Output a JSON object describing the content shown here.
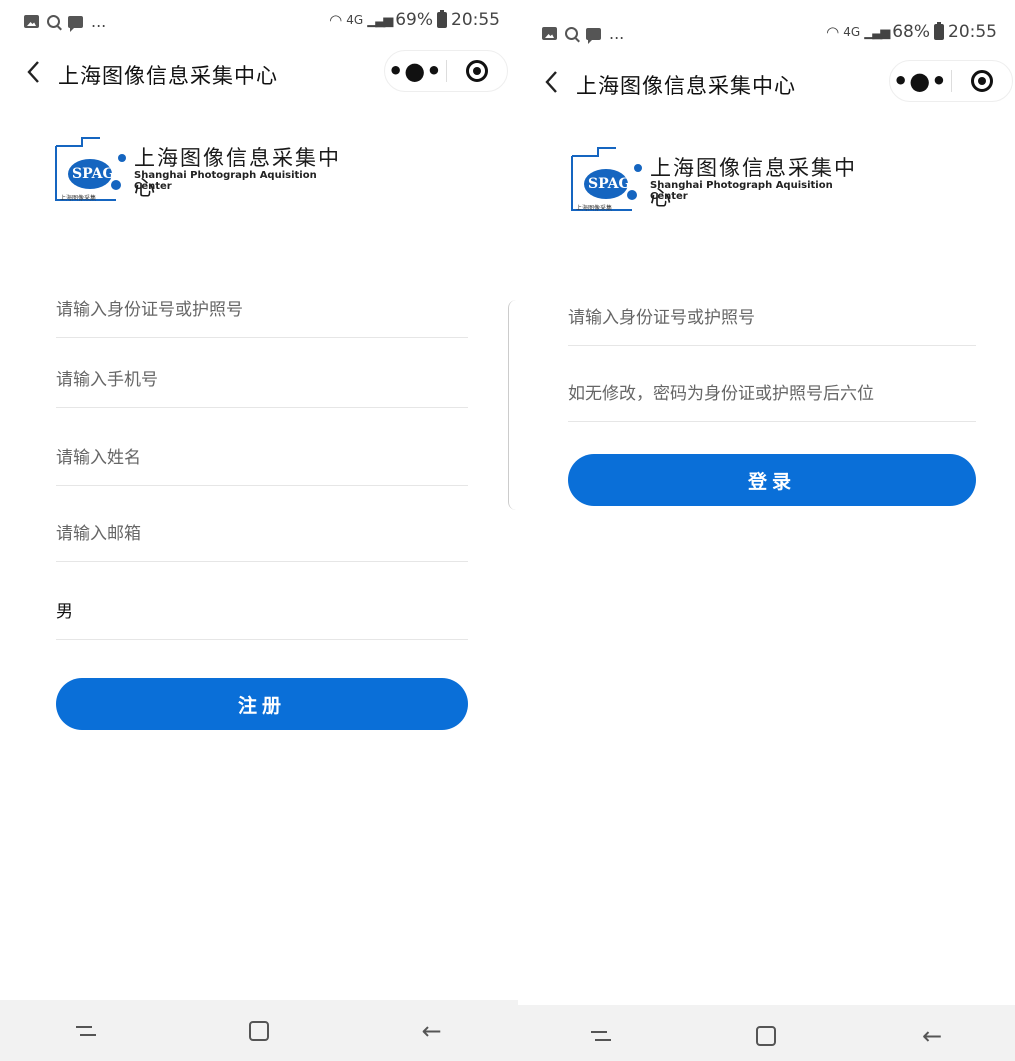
{
  "left_screen": {
    "status_bar": {
      "dots": "...",
      "network": "4G",
      "battery": "69%",
      "time": "20:55"
    },
    "nav": {
      "back_icon": "chevron-left-icon",
      "title": "上海图像信息采集中心",
      "more_icon": "more-dots-icon",
      "close_icon": "target-icon"
    },
    "logo": {
      "mark": "SPAG",
      "zh": "上海图像信息采集中心",
      "en": "Shanghai Photograph Aquisition Center",
      "small": "上海图像采集"
    },
    "fields": [
      {
        "placeholder": "请输入身份证号或护照号",
        "value": ""
      },
      {
        "placeholder": "请输入手机号",
        "value": ""
      },
      {
        "placeholder": "请输入姓名",
        "value": ""
      },
      {
        "placeholder": "请输入邮箱",
        "value": ""
      }
    ],
    "gender_value": "男",
    "register_button": "注册"
  },
  "right_screen": {
    "status_bar": {
      "dots": "...",
      "network": "4G",
      "battery": "68%",
      "time": "20:55"
    },
    "nav": {
      "back_icon": "chevron-left-icon",
      "title": "上海图像信息采集中心",
      "more_icon": "more-dots-icon",
      "close_icon": "target-icon"
    },
    "logo": {
      "mark": "SPAG",
      "zh": "上海图像信息采集中心",
      "en": "Shanghai Photograph Aquisition Center",
      "small": "上海图像采集"
    },
    "fields": [
      {
        "placeholder": "请输入身份证号或护照号",
        "value": ""
      },
      {
        "placeholder": "如无修改，密码为身份证或护照号后六位",
        "value": ""
      }
    ],
    "login_button": "登录"
  },
  "colors": {
    "primary": "#0a6fd8",
    "logo_blue": "#1565c0",
    "divider": "#e6e6e6",
    "sysnav_bg": "#f2f2f2"
  },
  "system_nav_icons": [
    "recent-apps-icon",
    "home-icon",
    "back-arrow-icon"
  ]
}
